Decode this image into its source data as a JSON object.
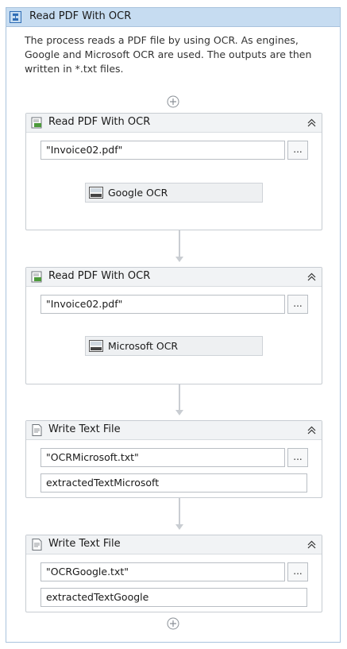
{
  "sequence": {
    "title": "Read PDF With OCR",
    "description": "The process reads a PDF file by using OCR. As engines, Google and Microsoft OCR are used. The outputs are then written in *.txt files."
  },
  "activities": [
    {
      "title": "Read PDF With OCR",
      "file": "\"Invoice02.pdf\"",
      "browse": "...",
      "engine": "Google OCR"
    },
    {
      "title": "Read PDF With OCR",
      "file": "\"Invoice02.pdf\"",
      "browse": "...",
      "engine": "Microsoft OCR"
    },
    {
      "title": "Write Text File",
      "file": "\"OCRMicrosoft.txt\"",
      "browse": "...",
      "text": "extractedTextMicrosoft"
    },
    {
      "title": "Write Text File",
      "file": "\"OCRGoogle.txt\"",
      "browse": "...",
      "text": "extractedTextGoogle"
    }
  ],
  "colors": {
    "header_bg": "#c6dcf1",
    "border": "#a9c3dd",
    "activity_border": "#c7ccd2"
  }
}
